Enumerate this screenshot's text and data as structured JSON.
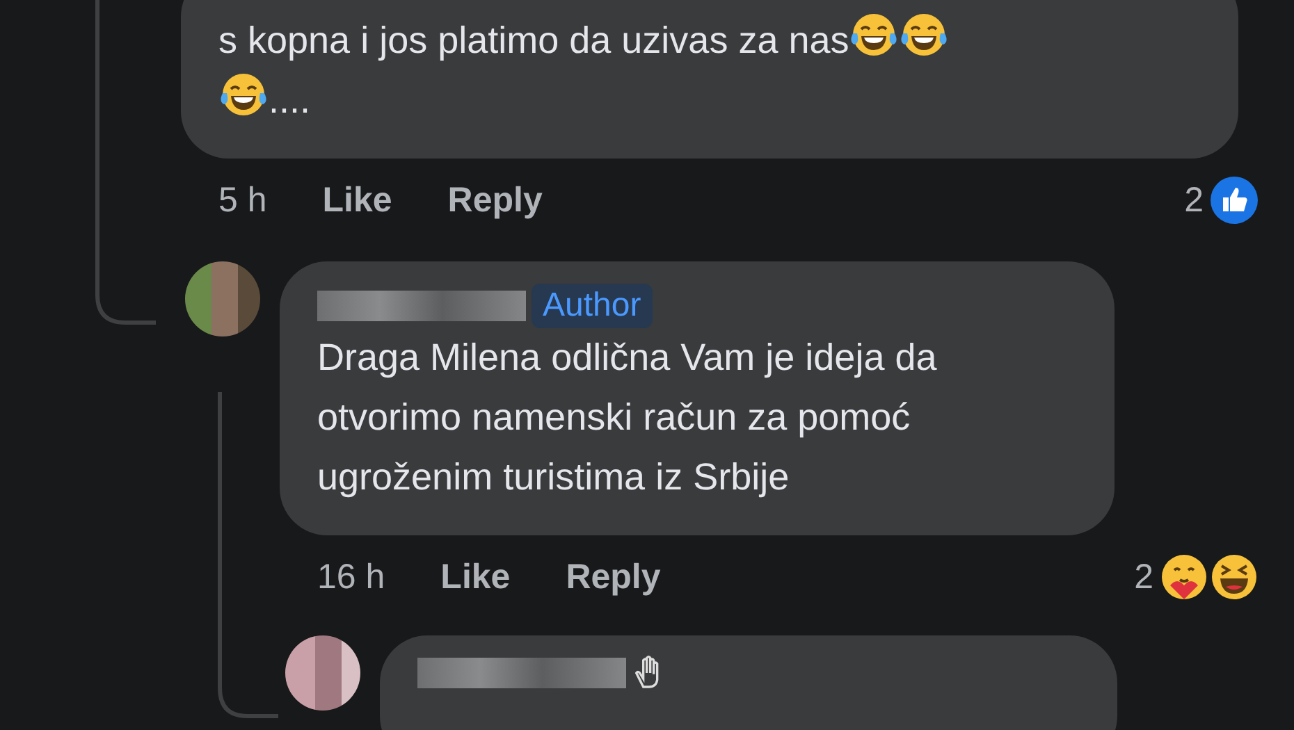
{
  "comments": [
    {
      "kind": "cut-off",
      "body": [
        {
          "kind": "text",
          "text": "s kopna i jos platimo da uzivas za nas"
        },
        {
          "kind": "tears-of-joy"
        },
        {
          "kind": "tears-of-joy"
        },
        {
          "kind": "break"
        },
        {
          "kind": "tears-of-joy"
        },
        {
          "kind": "text",
          "text": "...."
        }
      ],
      "time": "5 h",
      "like": "Like",
      "reply": "Reply",
      "reaction_count": "2",
      "reactions": [
        {
          "kind": "like"
        }
      ]
    },
    {
      "kind": "full",
      "badge": "Author",
      "body": [
        {
          "kind": "text",
          "text": "Draga Milena odlična Vam je ideja da otvorimo namenski račun za pomoć ugroženim turistima iz Srbije"
        }
      ],
      "time": "16 h",
      "like": "Like",
      "reply": "Reply",
      "reaction_count": "2",
      "reactions": [
        {
          "kind": "care"
        },
        {
          "kind": "haha"
        }
      ]
    },
    {
      "kind": "partial"
    }
  ]
}
